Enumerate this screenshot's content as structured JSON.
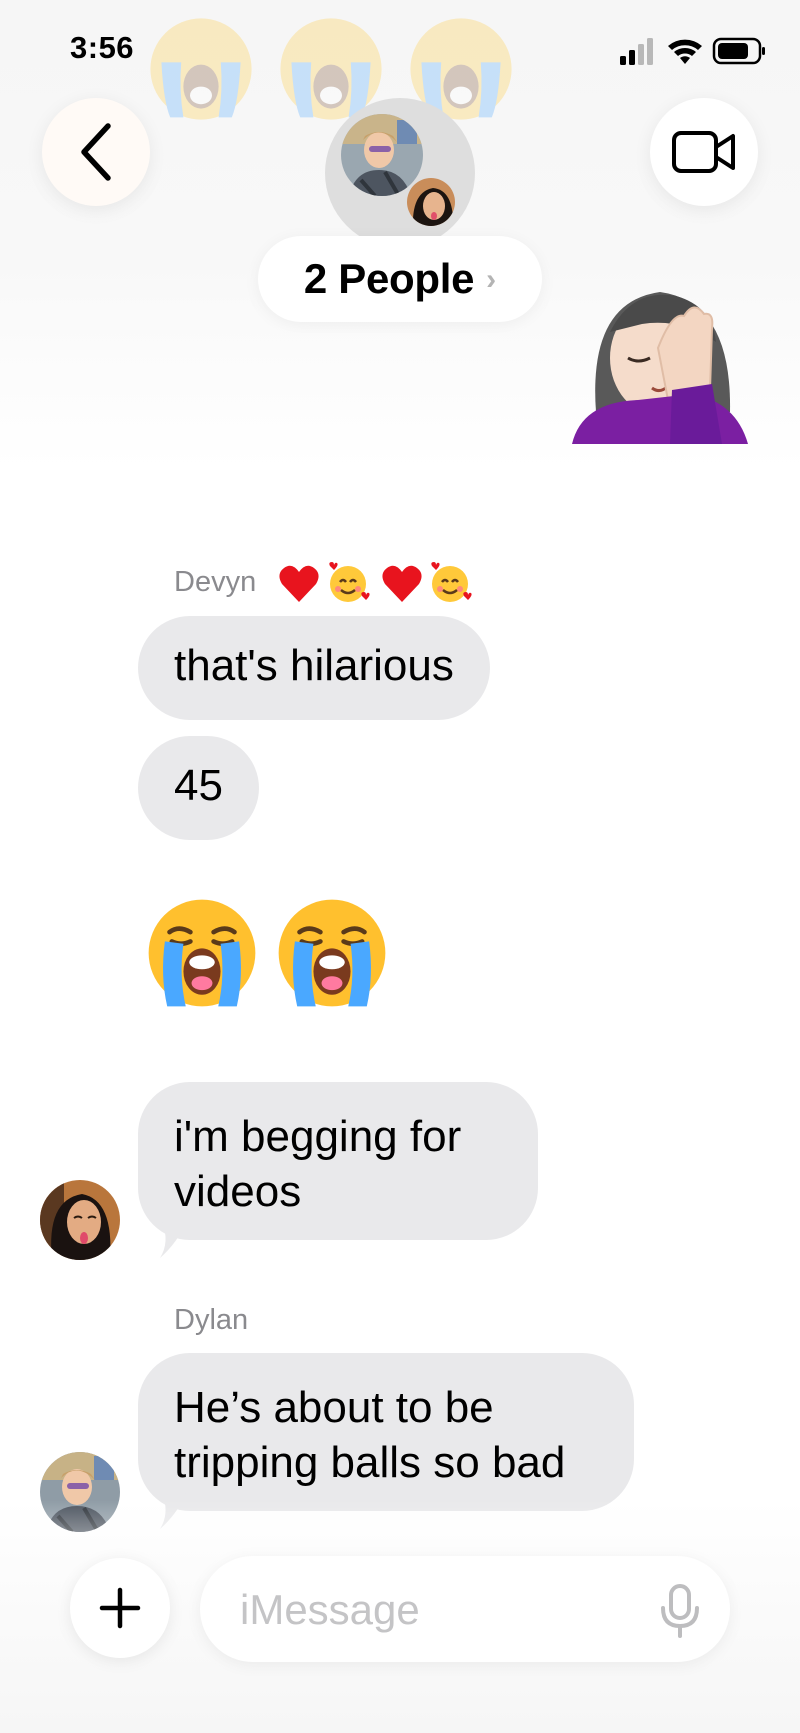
{
  "status_bar": {
    "time": "3:56"
  },
  "header": {
    "group_name": "2 People",
    "chevron": "›"
  },
  "messages": [
    {
      "sender": "Devyn",
      "tapbacks": [
        "heart",
        "smiling-face-with-hearts",
        "heart",
        "smiling-face-with-hearts"
      ]
    },
    {
      "text": "that's hilarious"
    },
    {
      "text": "45"
    },
    {
      "emoji": [
        "loudly-crying-face",
        "loudly-crying-face"
      ]
    },
    {
      "lines": [
        "i'm begging for",
        "videos"
      ]
    },
    {
      "sender": "Dylan"
    },
    {
      "lines": [
        "He’s about to be",
        "tripping balls so bad"
      ]
    }
  ],
  "composer": {
    "placeholder": "iMessage"
  },
  "colors": {
    "bubble_gray": "#e9e9eb",
    "sender_gray": "#8a8a8e",
    "placeholder_gray": "#c4c4c6"
  }
}
